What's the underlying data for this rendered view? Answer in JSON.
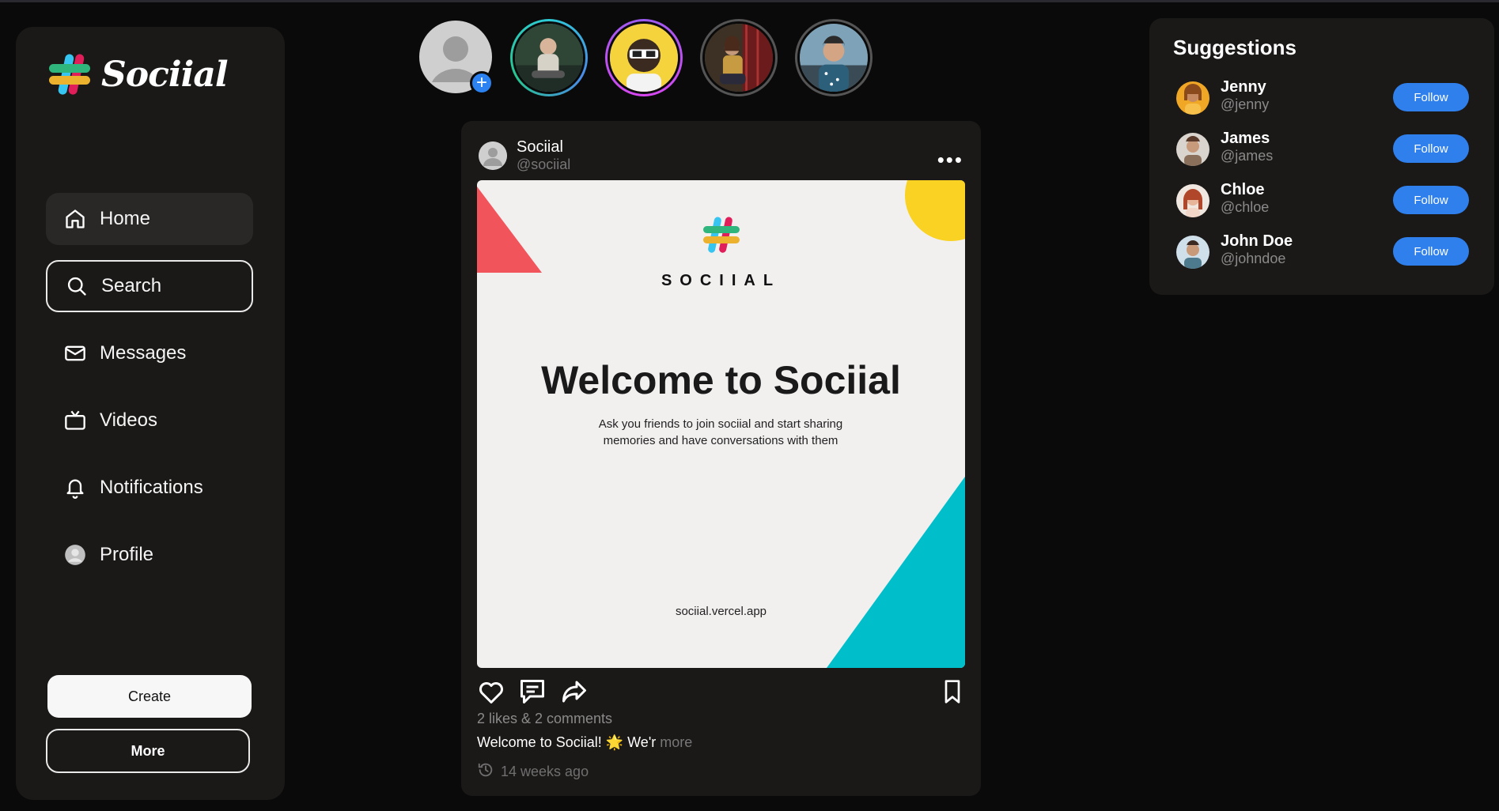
{
  "app": {
    "name": "Sociial"
  },
  "sidebar": {
    "items": [
      {
        "label": "Home",
        "icon": "home-icon"
      },
      {
        "label": "Search",
        "icon": "search-icon"
      },
      {
        "label": "Messages",
        "icon": "mail-icon"
      },
      {
        "label": "Videos",
        "icon": "tv-icon"
      },
      {
        "label": "Notifications",
        "icon": "bell-icon"
      },
      {
        "label": "Profile",
        "icon": "avatar-icon"
      }
    ],
    "create_label": "Create",
    "more_label": "More"
  },
  "stories": {
    "count": 5,
    "items": [
      "add-story",
      "story-1",
      "story-2",
      "story-3",
      "story-4"
    ]
  },
  "post": {
    "author_name": "Sociial",
    "author_handle": "@sociial",
    "image": {
      "wordmark": "SOCIIAL",
      "title": "Welcome to Sociial",
      "subtitle_line1": "Ask you friends to join sociial and start sharing",
      "subtitle_line2": "memories and have  conversations with them",
      "url": "sociial.vercel.app"
    },
    "stats": "2 likes & 2 comments",
    "caption": "Welcome to Sociial! 🌟 We'r",
    "caption_more": "more",
    "time": "14 weeks ago"
  },
  "suggestions": {
    "title": "Suggestions",
    "users": [
      {
        "name": "Jenny",
        "handle": "@jenny",
        "button": "Follow"
      },
      {
        "name": "James",
        "handle": "@james",
        "button": "Follow"
      },
      {
        "name": "Chloe",
        "handle": "@chloe",
        "button": "Follow"
      },
      {
        "name": "John Doe",
        "handle": "@johndoe",
        "button": "Follow"
      }
    ]
  },
  "colors": {
    "accent": "#2f80ed",
    "panel": "#1b1918",
    "background": "#0b0a0a"
  }
}
